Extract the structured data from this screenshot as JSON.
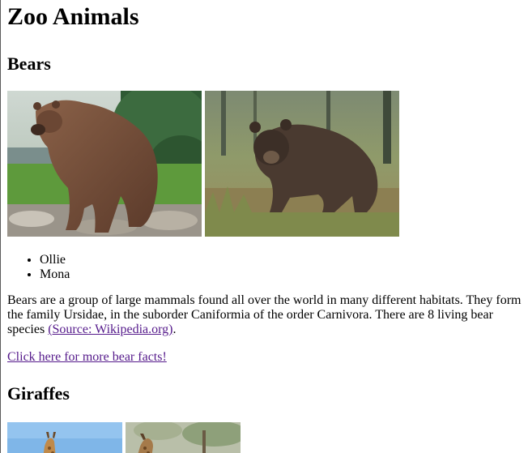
{
  "page": {
    "title": "Zoo Animals"
  },
  "bears": {
    "heading": "Bears",
    "images": [
      "brown-bear-standing-on-rock",
      "brown-bear-in-grass"
    ],
    "names": [
      "Ollie",
      "Mona"
    ],
    "description_text": "Bears are a group of large mammals found all over the world in many different habitats. They form the family Ursidae, in the suborder Caniformia of the order Carnivora. There are 8 living bear species ",
    "source_link": "(Source: Wikipedia.org)",
    "description_end": ".",
    "more_link": "Click here for more bear facts!"
  },
  "giraffes": {
    "heading": "Giraffes",
    "images": [
      "giraffe-sky",
      "giraffe-trees"
    ]
  },
  "colors": {
    "visited_link": "#551a8b",
    "text": "#000000",
    "background": "#ffffff"
  }
}
